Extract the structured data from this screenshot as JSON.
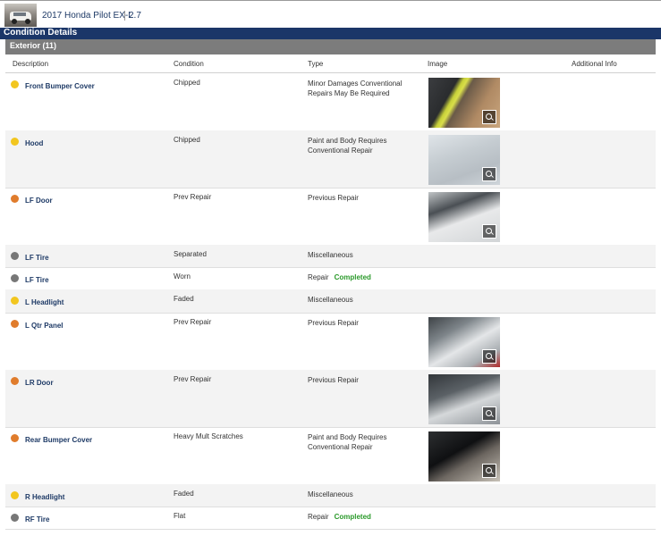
{
  "vehicle": {
    "title": "2017 Honda Pilot EX-L",
    "engine": "2.7"
  },
  "nav": {
    "title": "Condition Details"
  },
  "section": {
    "title": "Exterior (11)"
  },
  "columns": {
    "description": "Description",
    "condition": "Condition",
    "type": "Type",
    "image": "Image",
    "additional": "Additional Info"
  },
  "colors": {
    "yellow": "#f2c61f",
    "orange": "#e07c2c",
    "gray": "#777777",
    "completed": "#2b9a2b",
    "nav": "#1b3668"
  },
  "rows": [
    {
      "description": "Front Bumper Cover",
      "condition": "Chipped",
      "type": "Minor Damages Conventional Repairs May Be Required",
      "status": "",
      "severity": "yellow",
      "has_image": true
    },
    {
      "description": "Hood",
      "condition": "Chipped",
      "type": "Paint and Body Requires Conventional Repair",
      "status": "",
      "severity": "yellow",
      "has_image": true
    },
    {
      "description": "LF Door",
      "condition": "Prev Repair",
      "type": "Previous Repair",
      "status": "",
      "severity": "orange",
      "has_image": true
    },
    {
      "description": "LF Tire",
      "condition": "Separated",
      "type": "Miscellaneous",
      "status": "",
      "severity": "gray",
      "has_image": false
    },
    {
      "description": "LF Tire",
      "condition": "Worn",
      "type": "Repair",
      "status": "Completed",
      "severity": "gray",
      "has_image": false
    },
    {
      "description": "L Headlight",
      "condition": "Faded",
      "type": "Miscellaneous",
      "status": "",
      "severity": "yellow",
      "has_image": false
    },
    {
      "description": "L Qtr Panel",
      "condition": "Prev Repair",
      "type": "Previous Repair",
      "status": "",
      "severity": "orange",
      "has_image": true
    },
    {
      "description": "LR Door",
      "condition": "Prev Repair",
      "type": "Previous Repair",
      "status": "",
      "severity": "orange",
      "has_image": true
    },
    {
      "description": "Rear Bumper Cover",
      "condition": "Heavy Mult Scratches",
      "type": "Paint and Body Requires Conventional Repair",
      "status": "",
      "severity": "orange",
      "has_image": true
    },
    {
      "description": "R Headlight",
      "condition": "Faded",
      "type": "Miscellaneous",
      "status": "",
      "severity": "yellow",
      "has_image": false
    },
    {
      "description": "RF Tire",
      "condition": "Flat",
      "type": "Repair",
      "status": "Completed",
      "severity": "gray",
      "has_image": false
    }
  ]
}
